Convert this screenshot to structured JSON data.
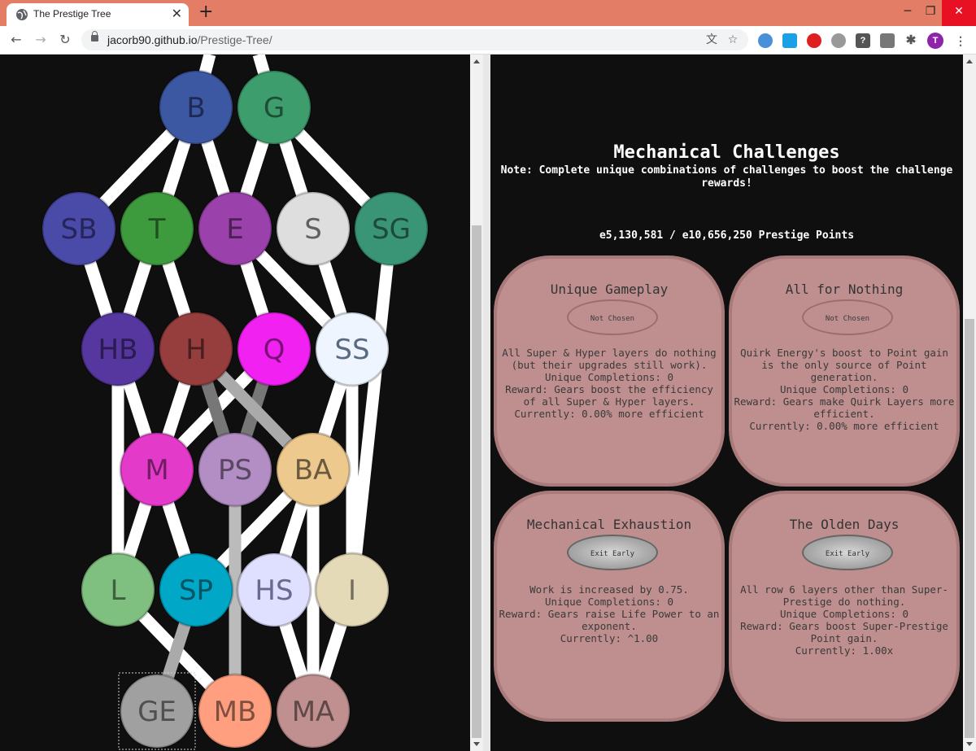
{
  "browser": {
    "tab_title": "The Prestige Tree",
    "url_host": "jacorb90.github.io",
    "url_path": "/Prestige-Tree/",
    "profile_initial": "T"
  },
  "tree": {
    "nodes": [
      {
        "label": "B",
        "color": "#3d58a3",
        "text": "#1e2a55"
      },
      {
        "label": "G",
        "color": "#3d9d6d",
        "text": "#1d4e36"
      },
      {
        "label": "SB",
        "color": "#4a4aa8",
        "text": "#25255a"
      },
      {
        "label": "T",
        "color": "#3d9b3d",
        "text": "#1f4f1f"
      },
      {
        "label": "E",
        "color": "#9a41ab",
        "text": "#4c2055"
      },
      {
        "label": "S",
        "color": "#dedede",
        "text": "#606060"
      },
      {
        "label": "SG",
        "color": "#3a9577",
        "text": "#1c4a3b"
      },
      {
        "label": "HB",
        "color": "#55379f",
        "text": "#2a1b50"
      },
      {
        "label": "H",
        "color": "#963d3d",
        "text": "#4b1e1e"
      },
      {
        "label": "Q",
        "color": "#f121f1",
        "text": "#781078"
      },
      {
        "label": "SS",
        "color": "#eef5ff",
        "text": "#5a6a80"
      },
      {
        "label": "M",
        "color": "#e33ac9",
        "text": "#711d64"
      },
      {
        "label": "PS",
        "color": "#b38ec5",
        "text": "#5a4763"
      },
      {
        "label": "BA",
        "color": "#edc98e",
        "text": "#6b5a3f"
      },
      {
        "label": "L",
        "color": "#7fbf7f",
        "text": "#3f603f"
      },
      {
        "label": "SP",
        "color": "#00a7c7",
        "text": "#005464"
      },
      {
        "label": "HS",
        "color": "#dfdfff",
        "text": "#6a6a90"
      },
      {
        "label": "I",
        "color": "#e5dab7",
        "text": "#736d5c"
      },
      {
        "label": "GE",
        "color": "#a0a0a0",
        "text": "#505050"
      },
      {
        "label": "MB",
        "color": "#ff9f7f",
        "text": "#7f4f3f"
      },
      {
        "label": "MA",
        "color": "#c08f8f",
        "text": "#604848"
      }
    ]
  },
  "challenges": {
    "title": "Mechanical Challenges",
    "note": "Note: Complete unique combinations of challenges to boost the challenge rewards!",
    "points": "e5,130,581 / e10,656,250 Prestige Points",
    "items": [
      {
        "name": "Unique Gameplay",
        "button": "Not Chosen",
        "desc": "All Super & Hyper layers do nothing (but their upgrades still work).\nUnique Completions: 0\nReward: Gears boost the efficiency of all Super & Hyper layers.\nCurrently: 0.00% more efficient"
      },
      {
        "name": "All for Nothing",
        "button": "Not Chosen",
        "desc": "Quirk Energy's boost to Point gain is the only source of Point generation.\nUnique Completions: 0\nReward: Gears make Quirk Layers more efficient.\nCurrently: 0.00% more efficient"
      },
      {
        "name": "Mechanical Exhaustion",
        "button": "Exit Early",
        "desc": "Work is increased by 0.75.\nUnique Completions: 0\nReward: Gears raise Life Power to an exponent.\nCurrently: ^1.00"
      },
      {
        "name": "The Olden Days",
        "button": "Exit Early",
        "desc": "All row 6 layers other than Super-Prestige do nothing.\nUnique Completions: 0\nReward: Gears boost Super-Prestige Point gain.\nCurrently: 1.00x"
      }
    ]
  }
}
